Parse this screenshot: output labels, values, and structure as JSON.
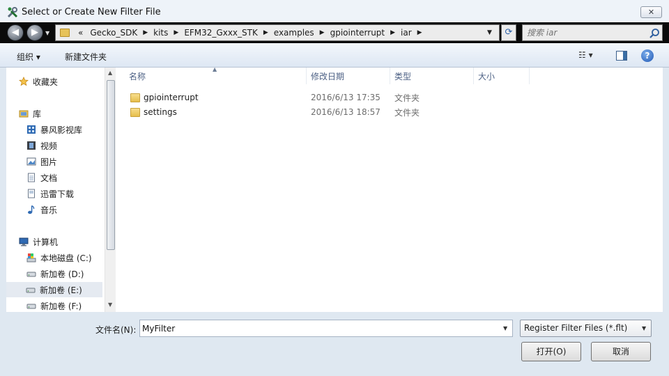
{
  "window": {
    "title": "Select or Create New Filter File",
    "close_glyph": "✕"
  },
  "addressbar": {
    "back_glyph": "◀",
    "forward_glyph": "▶",
    "overflow": "«",
    "crumbs": [
      "Gecko_SDK",
      "kits",
      "EFM32_Gxxx_STK",
      "examples",
      "gpiointerrupt",
      "iar"
    ],
    "search_placeholder": "搜索 iar"
  },
  "toolbar": {
    "organize_label": "组织 ▾",
    "new_folder_label": "新建文件夹",
    "view_glyph": "☷ ▾",
    "help_glyph": "?"
  },
  "navpane": {
    "favorites": "收藏夹",
    "library": "库",
    "library_items": [
      "暴风影视库",
      "视频",
      "图片",
      "文档",
      "迅雷下载",
      "音乐"
    ],
    "computer": "计算机",
    "drives": [
      "本地磁盘 (C:)",
      "新加卷 (D:)",
      "新加卷 (E:)",
      "新加卷 (F:)"
    ],
    "selected_drive": "新加卷 (E:)"
  },
  "filelist": {
    "columns": [
      "名称",
      "修改日期",
      "类型",
      "大小"
    ],
    "rows": [
      {
        "name": "gpiointerrupt",
        "date": "2016/6/13 17:35",
        "type": "文件夹"
      },
      {
        "name": "settings",
        "date": "2016/6/13 18:57",
        "type": "文件夹"
      }
    ]
  },
  "footer": {
    "filename_label": "文件名(N):",
    "filename_value": "MyFilter",
    "filetype": "Register Filter Files (*.flt)",
    "open_label": "打开(O)",
    "cancel_label": "取消"
  },
  "colors": {
    "accent": "#4d6185",
    "selection": "#e5eaf1",
    "addressbar_bg": "#0b0b0b"
  }
}
